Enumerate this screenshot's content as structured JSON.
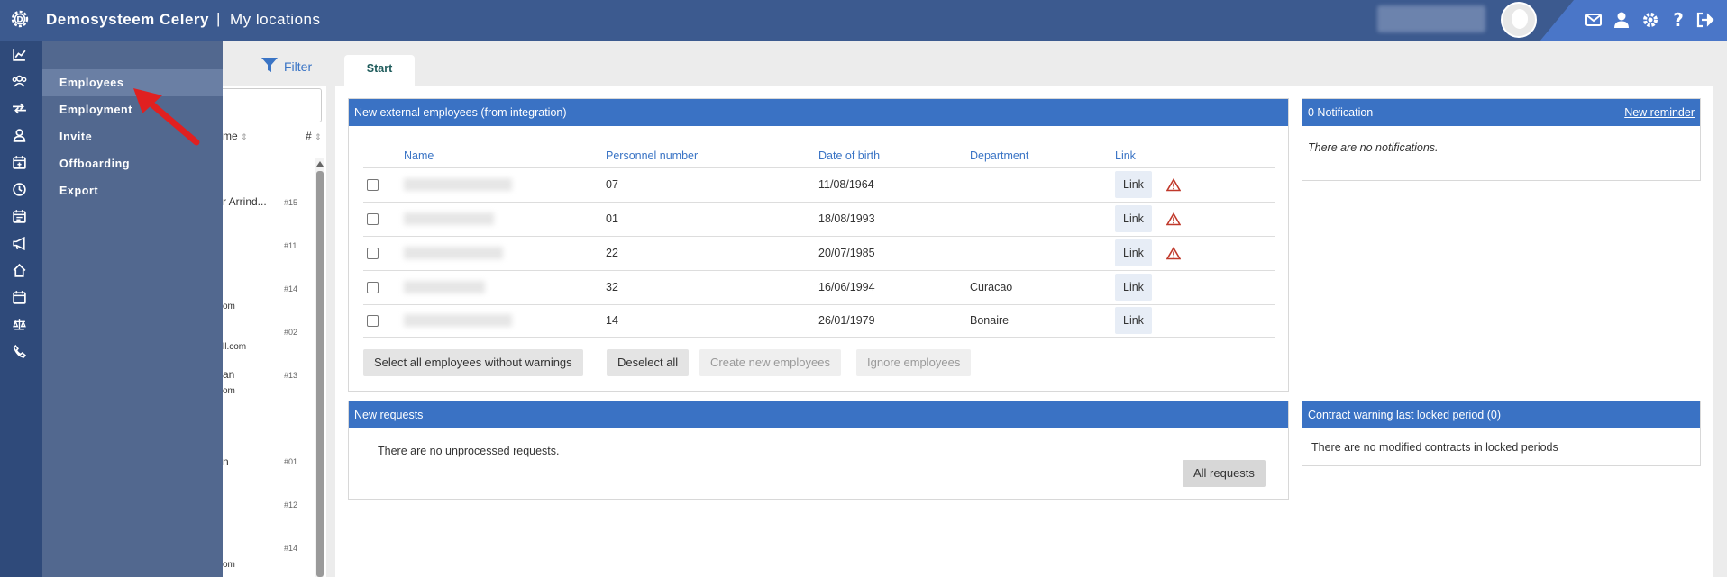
{
  "header": {
    "app_name": "Demosysteem Celery",
    "separator": "|",
    "page_title": "My locations"
  },
  "flyout": {
    "items": [
      {
        "label": "Employees"
      },
      {
        "label": "Employment"
      },
      {
        "label": "Invite"
      },
      {
        "label": "Offboarding"
      },
      {
        "label": "Export"
      }
    ]
  },
  "listpanel": {
    "col_name": "me",
    "col_number": "#",
    "fragments": [
      "r Arrind...",
      "om",
      "ll.com",
      "an",
      "om",
      "n",
      "om"
    ],
    "numbers": [
      "#15",
      "#11",
      "#14",
      "#02",
      "#13",
      "#01",
      "#12",
      "#14"
    ]
  },
  "toolbar": {
    "filter_label": "Filter",
    "tab_start": "Start"
  },
  "external": {
    "title": "New external employees (from integration)",
    "columns": [
      "Name",
      "Personnel number",
      "Date of birth",
      "Department",
      "Link"
    ],
    "rows": [
      {
        "personnel_number": "07",
        "dob": "11/08/1964",
        "department": "",
        "link": "Link",
        "warning": true
      },
      {
        "personnel_number": "01",
        "dob": "18/08/1993",
        "department": "",
        "link": "Link",
        "warning": true
      },
      {
        "personnel_number": "22",
        "dob": "20/07/1985",
        "department": "",
        "link": "Link",
        "warning": true
      },
      {
        "personnel_number": "32",
        "dob": "16/06/1994",
        "department": "Curacao",
        "link": "Link",
        "warning": false
      },
      {
        "personnel_number": "14",
        "dob": "26/01/1979",
        "department": "Bonaire",
        "link": "Link",
        "warning": false
      }
    ],
    "buttons": {
      "select_all": "Select all employees without warnings",
      "deselect_all": "Deselect all",
      "create": "Create new employees",
      "ignore": "Ignore employees"
    }
  },
  "notifications": {
    "title": "0 Notification",
    "new_reminder": "New reminder",
    "empty": "There are no notifications."
  },
  "requests": {
    "title": "New requests",
    "empty": "There are no unprocessed requests.",
    "all_button": "All requests"
  },
  "contract_warning": {
    "title": "Contract warning last locked period (0)",
    "empty": "There are no modified contracts in locked periods"
  },
  "colors": {
    "topbar": "#3c5a8f",
    "accent": "#3a72c4",
    "rail": "#2f4a7a",
    "flyout": "#52688f",
    "warning": "#c0392b",
    "arrow": "#e02020"
  }
}
